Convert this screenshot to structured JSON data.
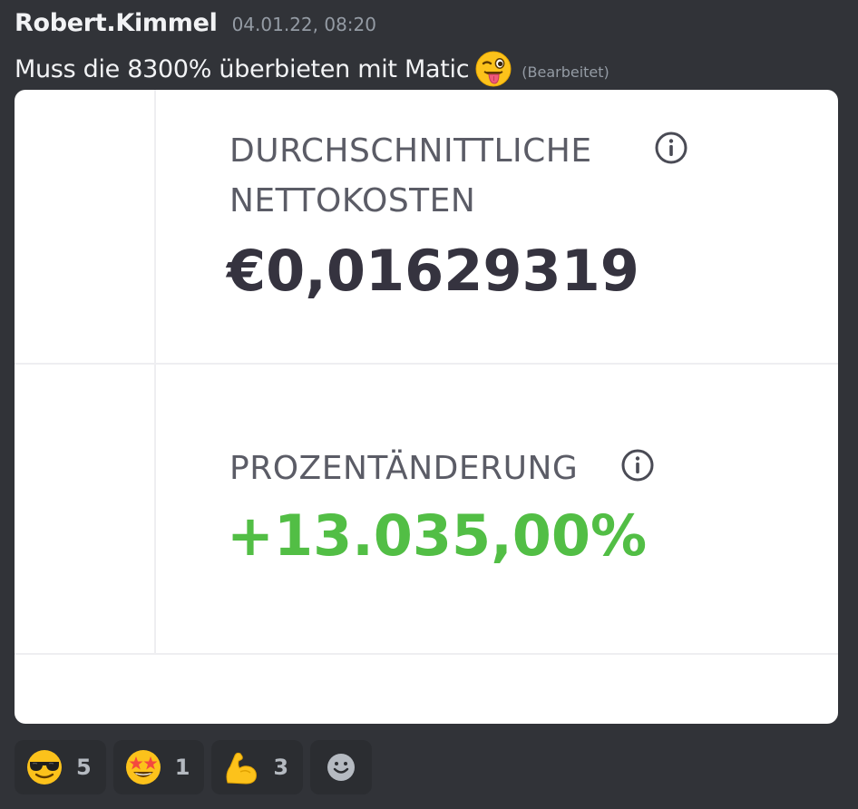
{
  "message": {
    "author": "Robert.Kimmel",
    "timestamp": "04.01.22, 08:20",
    "text": "Muss die 8300% überbieten mit Matic",
    "text_emoji": "winking-face-with-tongue",
    "edited_label": "(Bearbeitet)"
  },
  "embed": {
    "cost_label_line1": "DURCHSCHNITTLICHE",
    "cost_label_line2": "NETTOKOSTEN",
    "cost_value": "€0,01629319",
    "change_label": "PROZENTÄNDERUNG",
    "change_value": "+13.035,00%",
    "info_icon": "info-circle-icon",
    "colors": {
      "value_dark": "#35333f",
      "value_positive": "#52be45",
      "label": "#5b5c66"
    }
  },
  "reactions": [
    {
      "emoji": "smiling-face-with-sunglasses",
      "count": "5"
    },
    {
      "emoji": "star-struck",
      "count": "1"
    },
    {
      "emoji": "flexed-biceps",
      "count": "3"
    }
  ],
  "add_reaction_icon": "add-reaction-smiley-icon"
}
